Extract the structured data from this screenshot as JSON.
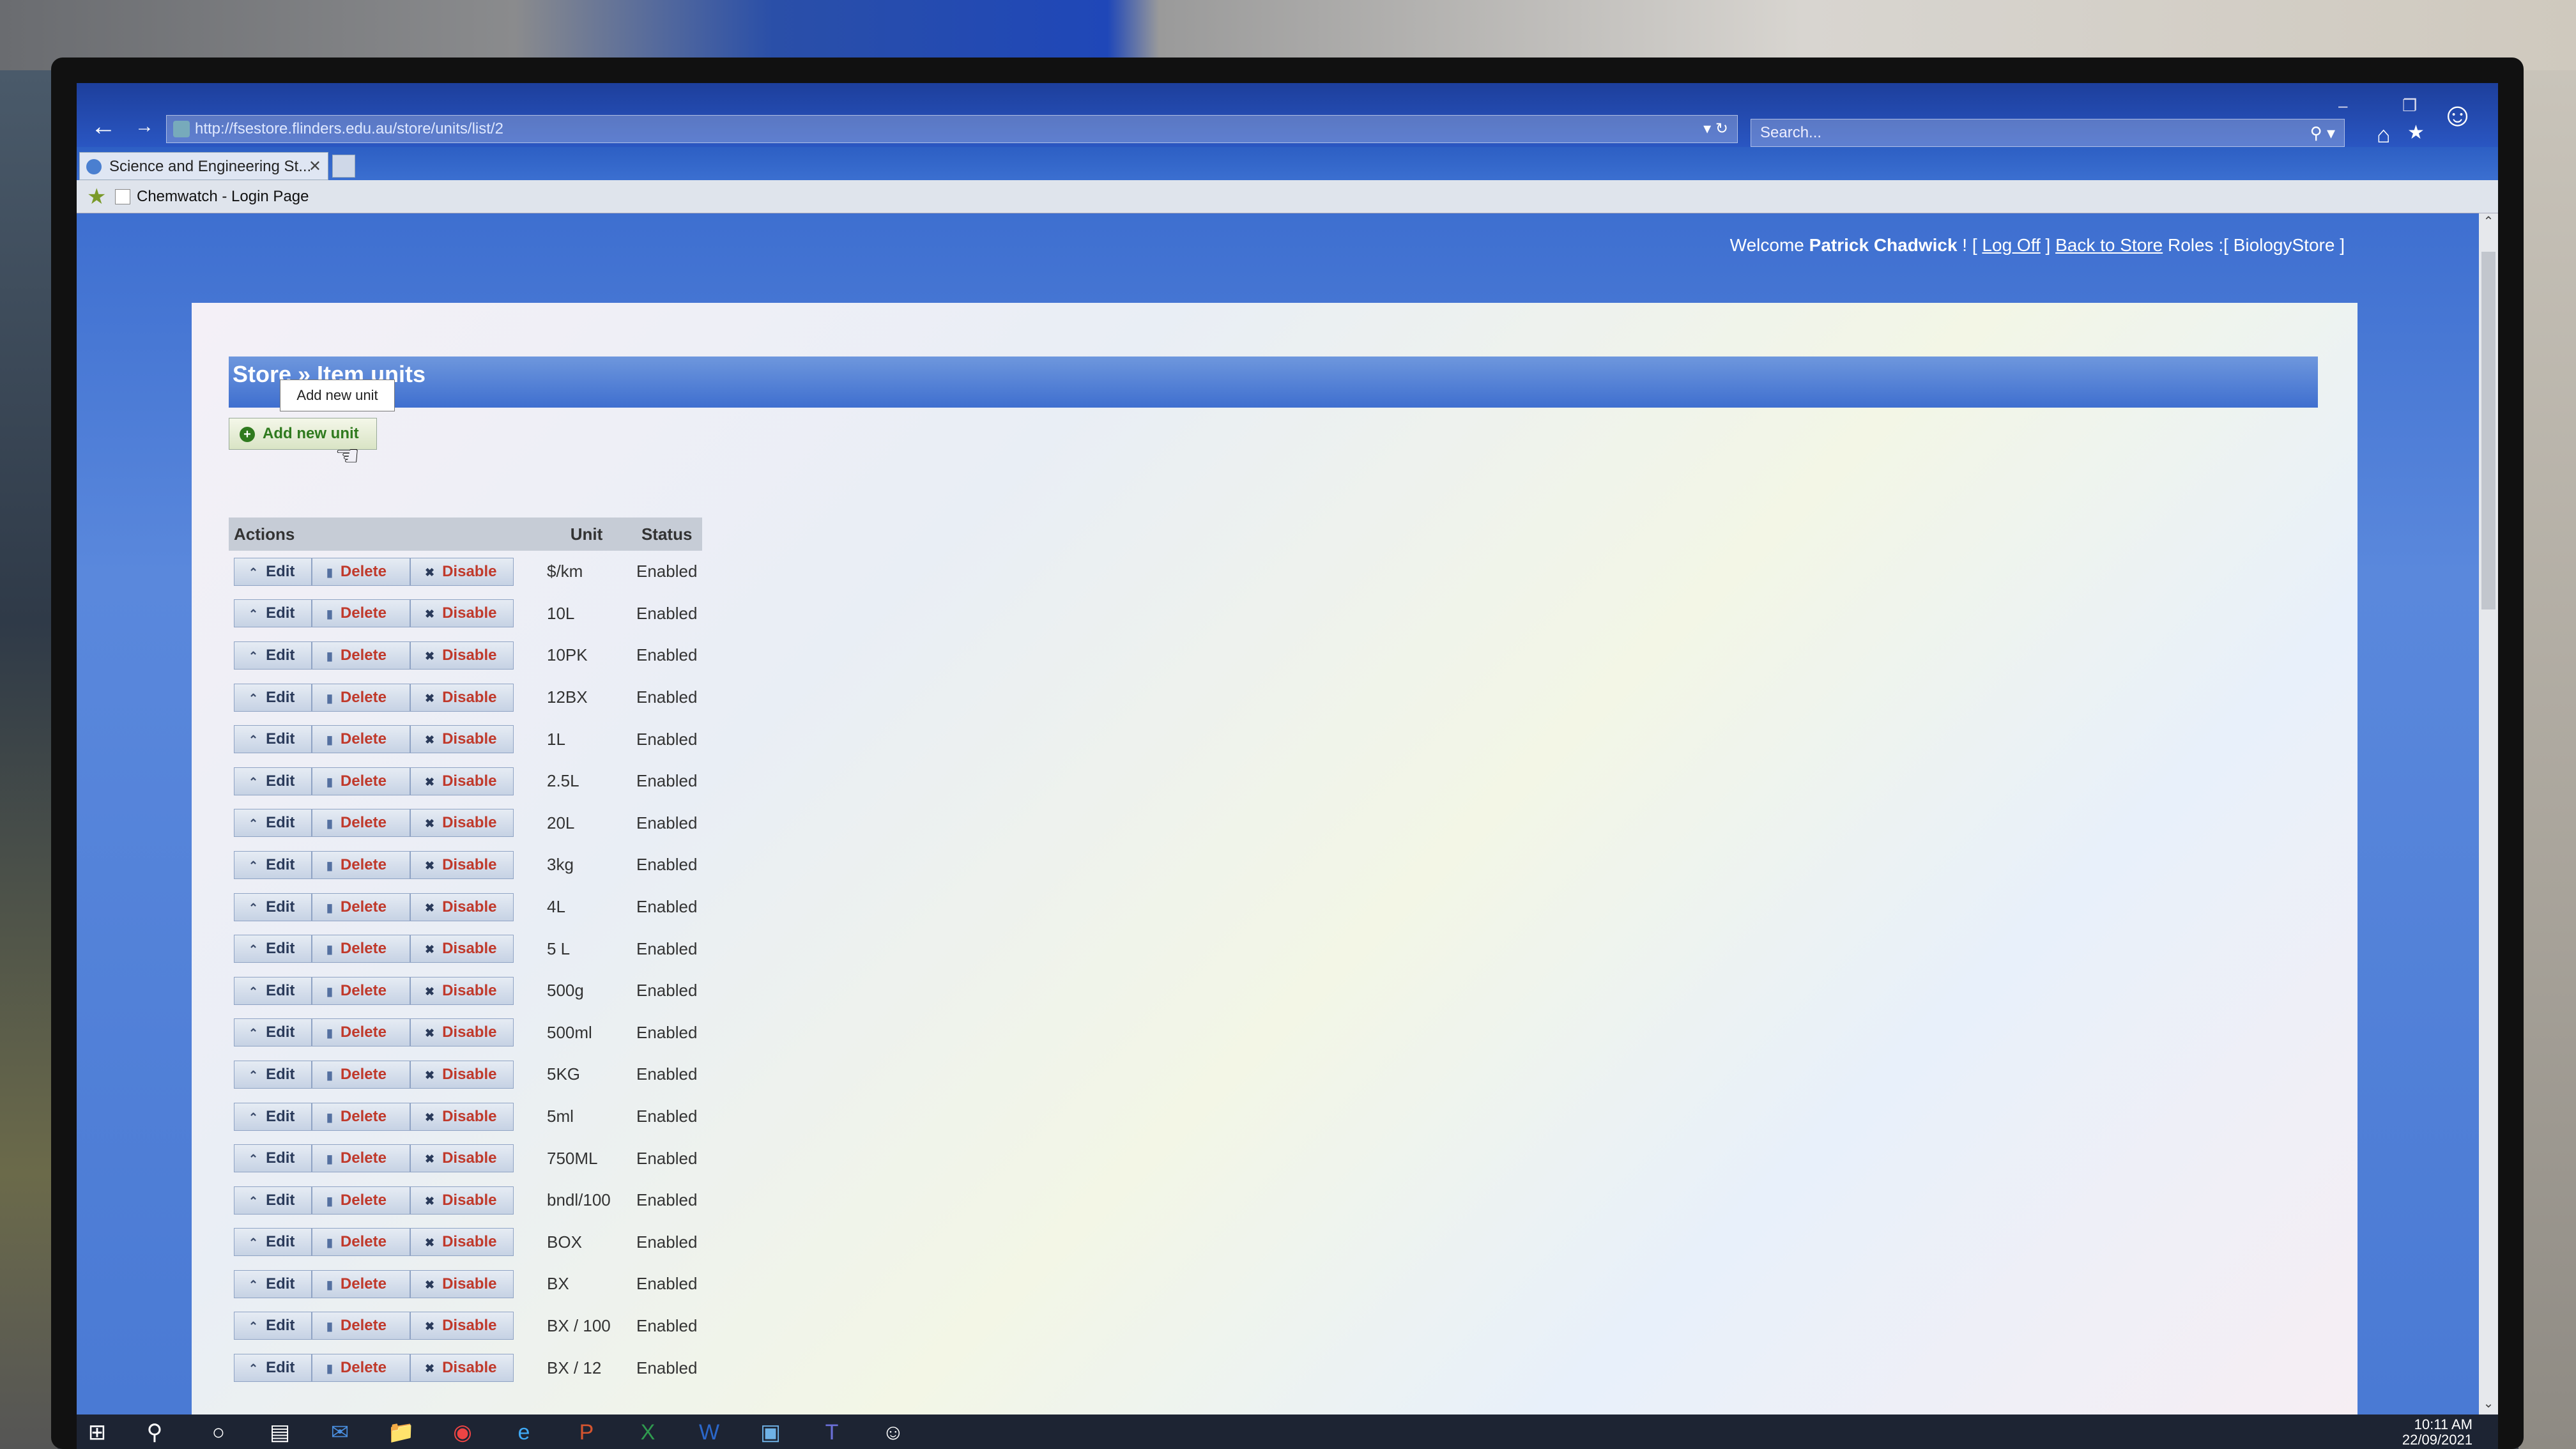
{
  "browser": {
    "address": "http://fsestore.flinders.edu.au/store/units/list/2",
    "search_placeholder": "Search...",
    "tab_title": "Science and Engineering St...",
    "favorite": "Chemwatch - Login Page"
  },
  "header": {
    "welcome_prefix": "Welcome",
    "user": "Patrick Chadwick",
    "sep1": "! [",
    "logoff": "Log Off",
    "sep2": "]",
    "back": "Back to Store",
    "roles": "Roles :[ BiologyStore ]"
  },
  "panel": {
    "title": "Store » Item units",
    "tooltip": "Add new unit",
    "add_button": "Add new unit"
  },
  "table": {
    "headers": {
      "actions": "Actions",
      "unit": "Unit",
      "status": "Status"
    },
    "buttons": {
      "edit": "Edit",
      "delete": "Delete",
      "disable": "Disable"
    },
    "rows": [
      {
        "unit": "$/km",
        "status": "Enabled"
      },
      {
        "unit": "10L",
        "status": "Enabled"
      },
      {
        "unit": "10PK",
        "status": "Enabled"
      },
      {
        "unit": "12BX",
        "status": "Enabled"
      },
      {
        "unit": "1L",
        "status": "Enabled"
      },
      {
        "unit": "2.5L",
        "status": "Enabled"
      },
      {
        "unit": "20L",
        "status": "Enabled"
      },
      {
        "unit": "3kg",
        "status": "Enabled"
      },
      {
        "unit": "4L",
        "status": "Enabled"
      },
      {
        "unit": "5 L",
        "status": "Enabled"
      },
      {
        "unit": "500g",
        "status": "Enabled"
      },
      {
        "unit": "500ml",
        "status": "Enabled"
      },
      {
        "unit": "5KG",
        "status": "Enabled"
      },
      {
        "unit": "5ml",
        "status": "Enabled"
      },
      {
        "unit": "750ML",
        "status": "Enabled"
      },
      {
        "unit": "bndl/100",
        "status": "Enabled"
      },
      {
        "unit": "BOX",
        "status": "Enabled"
      },
      {
        "unit": "BX",
        "status": "Enabled"
      },
      {
        "unit": "BX / 100",
        "status": "Enabled"
      },
      {
        "unit": "BX / 12",
        "status": "Enabled"
      }
    ]
  },
  "taskbar": {
    "time": "10:11 AM",
    "date": "22/09/2021"
  },
  "colors": {
    "accent": "#3f6fcf",
    "delete_text": "#c0392b",
    "add_text": "#2f7a1e"
  }
}
